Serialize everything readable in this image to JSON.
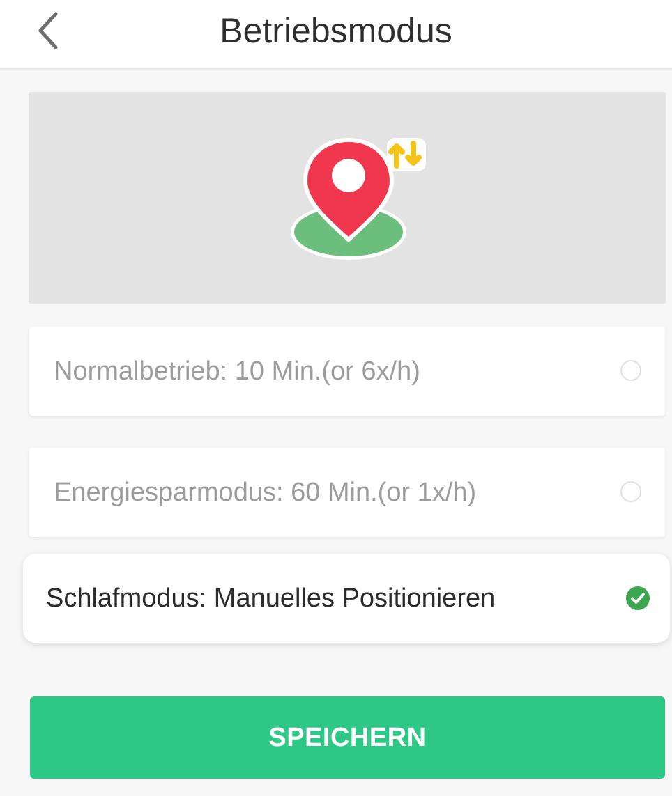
{
  "header": {
    "title": "Betriebsmodus",
    "back_icon": "chevron-left-icon"
  },
  "hero": {
    "icon": "map-pin-switch-icon",
    "pin_color": "#f0374e",
    "base_color": "#6cbe7c",
    "badge_color": "#f6c31a"
  },
  "options": [
    {
      "label": "Normalbetrieb: 10 Min.(or 6x/h)",
      "selected": false
    },
    {
      "label": "Energiesparmodus: 60 Min.(or 1x/h)",
      "selected": false
    },
    {
      "label": "Schlafmodus: Manuelles Positionieren",
      "selected": true
    }
  ],
  "actions": {
    "save_label": "SPEICHERN"
  },
  "colors": {
    "accent": "#2ec886",
    "check": "#3aa64f"
  }
}
